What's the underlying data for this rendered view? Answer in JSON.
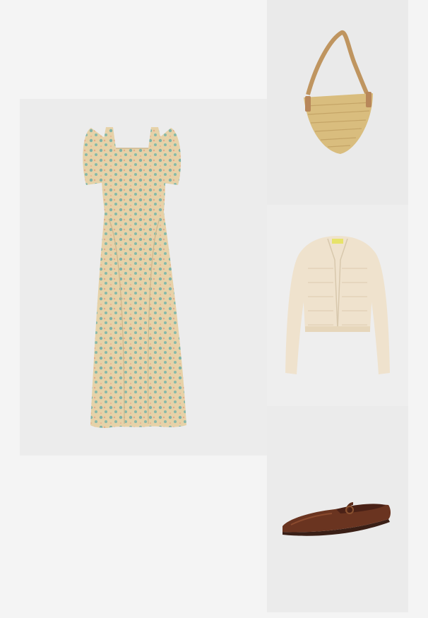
{
  "outfit": {
    "items": [
      {
        "icon": "floral-dress-icon"
      },
      {
        "icon": "straw-bag-icon"
      },
      {
        "icon": "cardigan-icon"
      },
      {
        "icon": "mary-jane-shoe-icon"
      }
    ],
    "cardigan_tag_color": "#e7e36a",
    "dress_colors": {
      "base": "#e6d2a8",
      "flower": "#7fb3a6",
      "accent": "#e5a98a"
    },
    "bag_colors": {
      "straw": "#d9bd7e",
      "strap": "#bf9560"
    },
    "cardigan_color": "#efe2cd",
    "shoe_color": "#6a3420"
  }
}
